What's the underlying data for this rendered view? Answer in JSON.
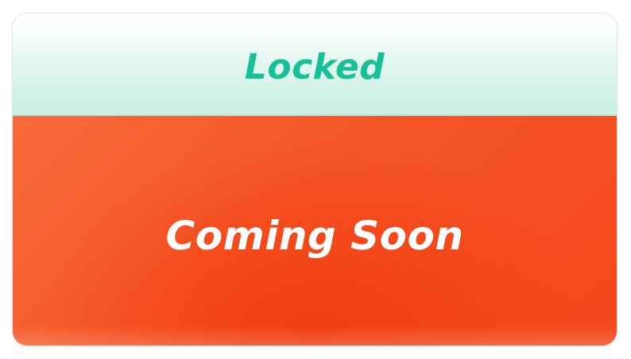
{
  "card": {
    "header_title": "Locked",
    "body_text": "Coming Soon"
  },
  "colors": {
    "header_text": "#17c096",
    "body_background": "#f55627",
    "body_text": "#ffffff"
  }
}
